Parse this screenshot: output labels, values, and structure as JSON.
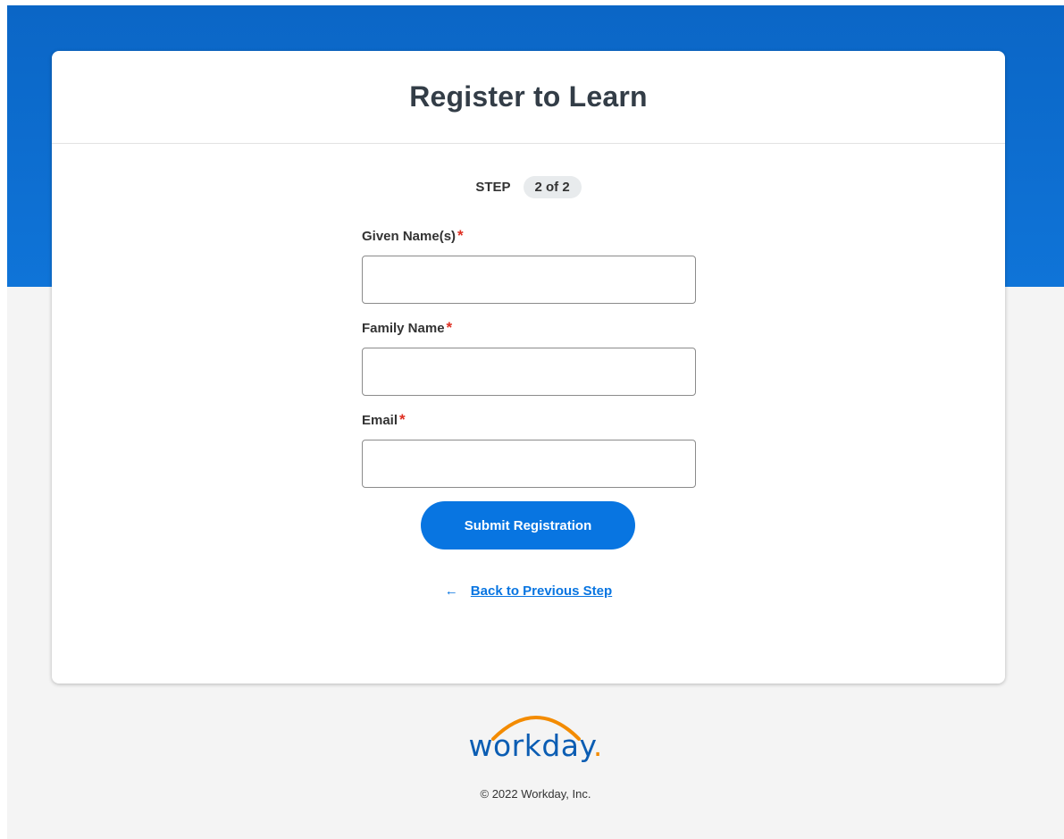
{
  "app": {
    "title": "Register to Learn",
    "accent_color": "#0875e1",
    "brand_color": "#0b66c6",
    "required_color": "#de2e21"
  },
  "step": {
    "label": "STEP",
    "value": "2 of 2"
  },
  "form": {
    "fields": [
      {
        "label": "Given Name(s)",
        "required_mark": "*",
        "value": "",
        "placeholder": ""
      },
      {
        "label": "Family Name",
        "required_mark": "*",
        "value": "",
        "placeholder": ""
      },
      {
        "label": "Email",
        "required_mark": "*",
        "value": "",
        "placeholder": ""
      }
    ],
    "submit_label": "Submit Registration",
    "back_arrow": "←",
    "back_label": "Back to Previous Step"
  },
  "footer": {
    "logo_text": "workday",
    "logo_dot": ".",
    "copyright": "© 2022 Workday, Inc."
  }
}
